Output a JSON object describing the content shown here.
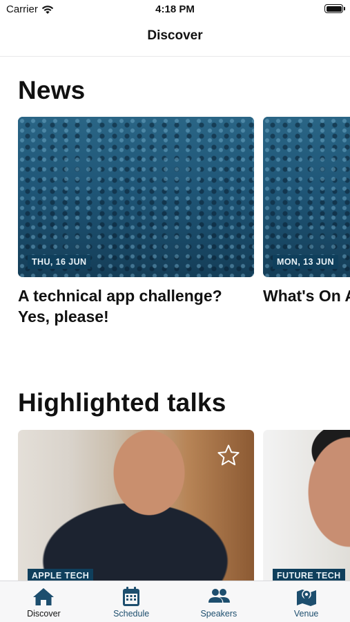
{
  "status_bar": {
    "carrier": "Carrier",
    "time": "4:18 PM"
  },
  "nav": {
    "title": "Discover"
  },
  "news": {
    "title": "News",
    "items": [
      {
        "date": "THU, 16 JUN",
        "headline": "A technical app challenge? Yes, please!"
      },
      {
        "date": "MON, 13 JUN",
        "headline": "What's On A"
      }
    ]
  },
  "talks": {
    "title": "Highlighted talks",
    "items": [
      {
        "category": "APPLE TECH"
      },
      {
        "category": "FUTURE TECH"
      }
    ]
  },
  "tab_bar": {
    "active": "Discover",
    "items": [
      {
        "label": "Discover",
        "icon": "house-icon"
      },
      {
        "label": "Schedule",
        "icon": "calendar-icon"
      },
      {
        "label": "Speakers",
        "icon": "people-icon"
      },
      {
        "label": "Venue",
        "icon": "map-icon"
      }
    ]
  },
  "colors": {
    "accent": "#1d4e6e",
    "badge_bg": "#0f3f5c"
  }
}
